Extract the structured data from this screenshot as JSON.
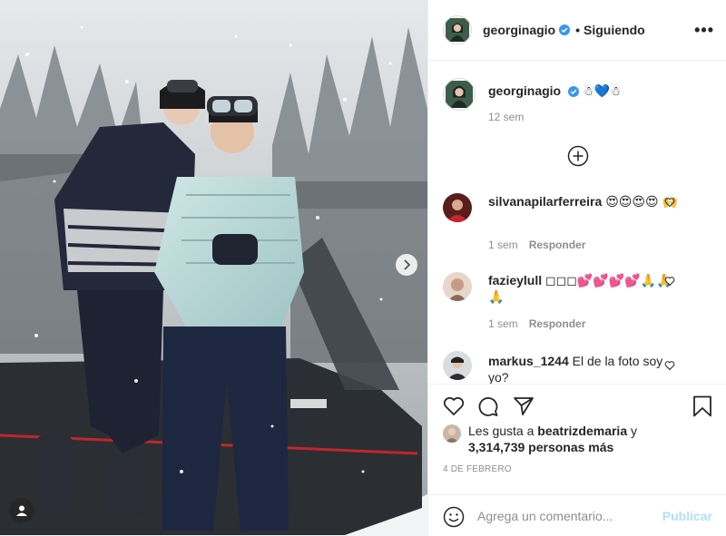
{
  "header": {
    "username": "georginagio",
    "separator": "•",
    "follow_status": "Siguiendo",
    "more_label": "•••"
  },
  "caption": {
    "username": "georginagio",
    "emoji": "☃💙☃",
    "time": "12 sem"
  },
  "comments": [
    {
      "username": "silvanapilarferreira",
      "text": "😍😍😍😍 🙌",
      "time": "1 sem",
      "reply": "Responder"
    },
    {
      "username": "fazieylull",
      "text": "◻◻◻💕💕💕💕🙏🙏 🙏",
      "time": "1 sem",
      "reply": "Responder"
    },
    {
      "username": "markus_1244",
      "text": "El de la foto soy yo?"
    }
  ],
  "likes": {
    "prefix": "Les gusta a",
    "first_liker": "beatrizdemaria",
    "conjunction": "y",
    "others": "3,314,739 personas más"
  },
  "date": "4 DE FEBRERO",
  "composer": {
    "placeholder": "Agrega un comentario...",
    "post_label": "Publicar"
  },
  "colors": {
    "verified": "#3897f0",
    "publish_disabled": "#b2dffc",
    "meta_text": "#8e8e8e"
  },
  "icons": {
    "verified": "verified-badge-icon",
    "more": "more-options-icon",
    "load_more": "plus-circle-icon",
    "heart": "heart-outline-icon",
    "comment": "comment-bubble-icon",
    "share": "paper-plane-icon",
    "save": "bookmark-icon",
    "emoji": "smiley-icon",
    "next": "chevron-right-icon",
    "tag": "user-tag-icon"
  }
}
